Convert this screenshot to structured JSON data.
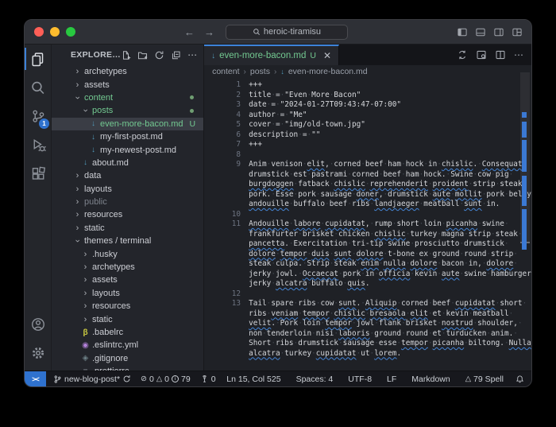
{
  "colors": {
    "accent_blue": "#3d82d8",
    "remote_chip_blue": "#2f72cf",
    "git_untracked_green": "#73c991",
    "markdown_icon_blue": "#519aba",
    "spell_squiggle_blue": "#4585d6",
    "selected_row": "#3a3d45"
  },
  "titlebar": {
    "search_text": "heroic-tiramisu"
  },
  "activity_bar": {
    "scm_badge": "1"
  },
  "explorer": {
    "title": "EXPLORE…",
    "tree": [
      {
        "label": "archetypes",
        "level": 0,
        "chevron": "collapsed"
      },
      {
        "label": "assets",
        "level": 0,
        "chevron": "collapsed"
      },
      {
        "label": "content",
        "level": 0,
        "chevron": "expanded",
        "green": true,
        "dot": true
      },
      {
        "label": "posts",
        "level": 1,
        "chevron": "expanded",
        "green": true,
        "dot": true
      },
      {
        "label": "even-more-bacon.md",
        "level": 2,
        "icon": "markdown",
        "green": true,
        "git": "U",
        "selected": true
      },
      {
        "label": "my-first-post.md",
        "level": 2,
        "icon": "markdown"
      },
      {
        "label": "my-newest-post.md",
        "level": 2,
        "icon": "markdown"
      },
      {
        "label": "about.md",
        "level": 1,
        "icon": "markdown"
      },
      {
        "label": "data",
        "level": 0,
        "chevron": "collapsed"
      },
      {
        "label": "layouts",
        "level": 0,
        "chevron": "collapsed"
      },
      {
        "label": "public",
        "level": 0,
        "chevron": "collapsed",
        "dim": true
      },
      {
        "label": "resources",
        "level": 0,
        "chevron": "collapsed"
      },
      {
        "label": "static",
        "level": 0,
        "chevron": "collapsed"
      },
      {
        "label": "themes / terminal",
        "level": 0,
        "chevron": "expanded"
      },
      {
        "label": ".husky",
        "level": 1,
        "chevron": "collapsed"
      },
      {
        "label": "archetypes",
        "level": 1,
        "chevron": "collapsed"
      },
      {
        "label": "assets",
        "level": 1,
        "chevron": "collapsed"
      },
      {
        "label": "layouts",
        "level": 1,
        "chevron": "collapsed"
      },
      {
        "label": "resources",
        "level": 1,
        "chevron": "collapsed"
      },
      {
        "label": "static",
        "level": 1,
        "chevron": "collapsed"
      },
      {
        "label": ".babelrc",
        "level": 1,
        "icon": "babel"
      },
      {
        "label": ".eslintrc.yml",
        "level": 1,
        "icon": "eslint"
      },
      {
        "label": ".gitignore",
        "level": 1,
        "icon": "git"
      },
      {
        "label": ".prettierrc",
        "level": 1,
        "icon": "prettier"
      }
    ]
  },
  "tab": {
    "file_name": "even-more-bacon.md",
    "git_badge": "U"
  },
  "breadcrumb": {
    "items": [
      "content",
      "posts",
      "even-more-bacon.md"
    ]
  },
  "editor": {
    "lines": [
      {
        "num": "1",
        "text": "+++"
      },
      {
        "num": "2",
        "text": "title = \"Even More Bacon\""
      },
      {
        "num": "3",
        "text": "date = \"2024-01-27T09:43:47-07:00\""
      },
      {
        "num": "4",
        "text": "author = \"Me\""
      },
      {
        "num": "5",
        "text": "cover = \"img/old-town.jpg\""
      },
      {
        "num": "6",
        "text": "description = \"\""
      },
      {
        "num": "7",
        "text": "+++"
      },
      {
        "num": "8",
        "text": ""
      },
      {
        "num": "9",
        "text": "Anim venison elit, corned beef ham hock in chislic. Consequat drumstick est pastrami corned beef ham hock. Swine cow pig burgdoggen fatback chislic reprehenderit proident strip steak pork. Esse pork sausage doner, drumstick aute mollit pork belly andouille buffalo beef ribs landjaeger meatball sunt in."
      },
      {
        "num": "10",
        "text": ""
      },
      {
        "num": "11",
        "text": "Andouille labore cupidatat, rump short loin picanha swine frankfurter brisket chicken chislic turkey magna strip steak pancetta. Exercitation tri-tip swine prosciutto drumstick dolore tempor duis sunt dolore t-bone ex ground round strip steak culpa. Strip steak enim nulla dolore bacon in, dolore jerky jowl. Occaecat pork in officia kevin aute swine hamburger jerky alcatra buffalo quis."
      },
      {
        "num": "12",
        "text": ""
      },
      {
        "num": "13",
        "text": "Tail spare ribs cow sunt. Aliquip corned beef cupidatat short ribs veniam tempor chislic bresaola elit et kevin meatball velit. Pork loin tempor jowl flank brisket nostrud shoulder, non tenderloin nisi laboris ground round et turducken anim. Short ribs drumstick sausage esse tempor picanha biltong. Nulla alcatra turkey cupidatat ut lorem."
      }
    ],
    "misspelled": [
      "elit",
      "chislic",
      "Consequat",
      "burgdoggen",
      "reprehenderit",
      "proident",
      "doner",
      "aute",
      "mollit",
      "andouille",
      "Andouille",
      "landjaeger",
      "sunt",
      "labore",
      "cupidatat",
      "picanha",
      "pancetta",
      "dolore",
      "tempor",
      "duis",
      "enim",
      "nulla",
      "Nulla",
      "Occaecat",
      "officia",
      "alcatra",
      "quis",
      "Aliquip",
      "veniam",
      "bresaola",
      "velit",
      "nostrud",
      "laboris",
      "lorem"
    ]
  },
  "status_bar": {
    "branch": "new-blog-post*",
    "errors": "0",
    "warnings": "0",
    "infos": "79",
    "broadcast": "0",
    "cursor": "Ln 15, Col 525",
    "indent": "Spaces: 4",
    "encoding": "UTF-8",
    "eol": "LF",
    "language": "Markdown",
    "spell": "79 Spell"
  }
}
